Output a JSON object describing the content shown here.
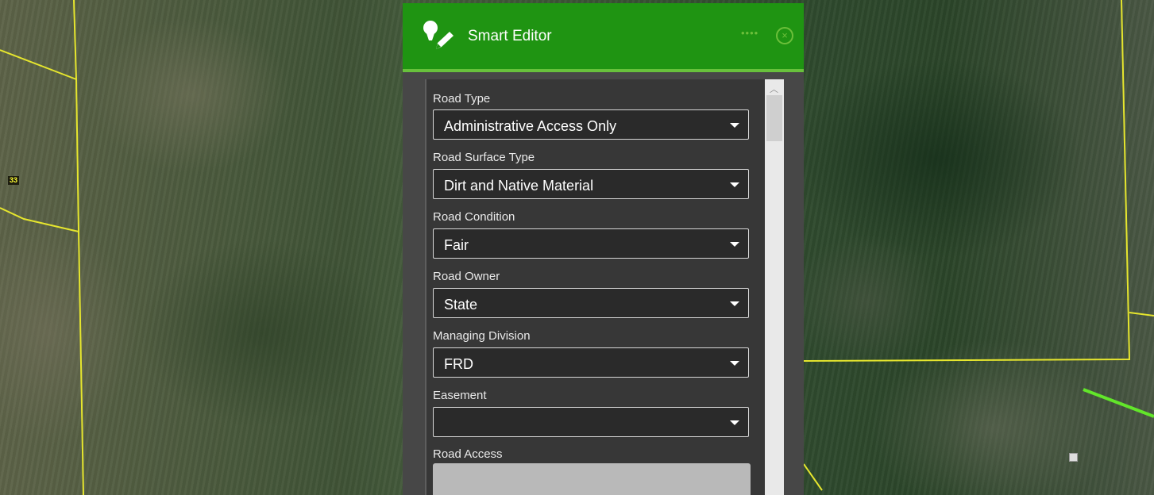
{
  "map": {
    "parcel_label": "33",
    "colors": {
      "parcel_line": "#e6e62e",
      "road_line": "#62e62a"
    }
  },
  "panel": {
    "title": "Smart Editor",
    "icons": {
      "title": "smart-editor-icon",
      "more": "more-icon",
      "close": "close-icon"
    },
    "more_glyph": "••••",
    "close_glyph": "×",
    "header_color": "#1f9412",
    "accent_color": "#68c13c"
  },
  "form": {
    "fields": [
      {
        "label": "Road Type",
        "value": "Administrative Access Only"
      },
      {
        "label": "Road Surface Type",
        "value": "Dirt and Native Material"
      },
      {
        "label": "Road Condition",
        "value": "Fair"
      },
      {
        "label": "Road Owner",
        "value": "State"
      },
      {
        "label": "Managing Division",
        "value": "FRD"
      },
      {
        "label": "Easement",
        "value": ""
      }
    ],
    "road_access_label": "Road Access",
    "road_access_value": ""
  }
}
